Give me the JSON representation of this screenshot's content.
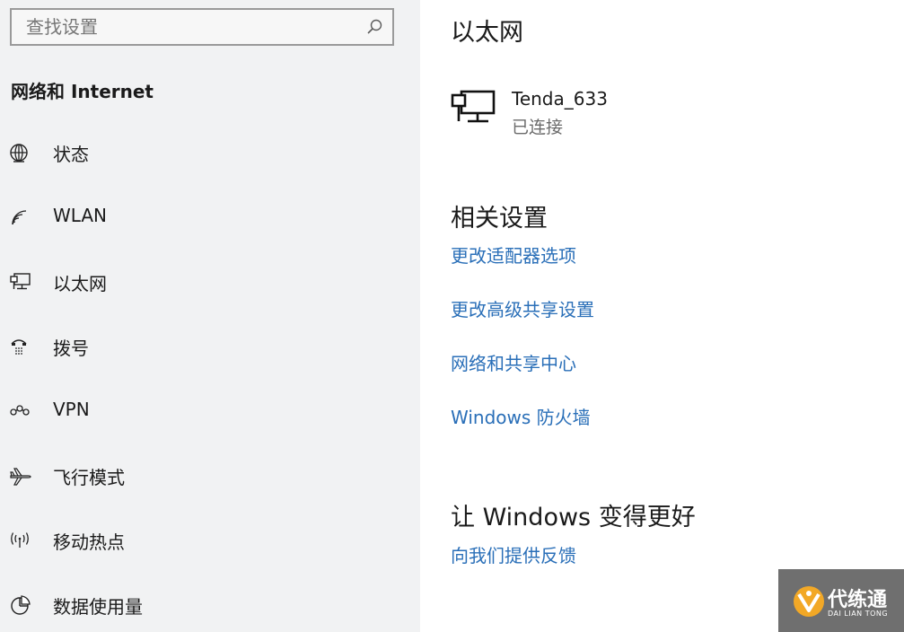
{
  "search": {
    "placeholder": "查找设置",
    "icon": "search-icon"
  },
  "sidebar": {
    "heading": "网络和 Internet",
    "items": [
      {
        "label": "状态",
        "icon": "globe-icon"
      },
      {
        "label": "WLAN",
        "icon": "wifi-icon"
      },
      {
        "label": "以太网",
        "icon": "ethernet-icon"
      },
      {
        "label": "拨号",
        "icon": "dialup-icon"
      },
      {
        "label": "VPN",
        "icon": "vpn-icon"
      },
      {
        "label": "飞行模式",
        "icon": "airplane-icon"
      },
      {
        "label": "移动热点",
        "icon": "hotspot-icon"
      },
      {
        "label": "数据使用量",
        "icon": "data-usage-icon"
      }
    ]
  },
  "main": {
    "title": "以太网",
    "network": {
      "name": "Tenda_633",
      "status": "已连接",
      "icon": "ethernet-icon"
    },
    "related": {
      "title": "相关设置",
      "links": [
        "更改适配器选项",
        "更改高级共享设置",
        "网络和共享中心",
        "Windows 防火墙"
      ]
    },
    "feedback": {
      "title": "让 Windows 变得更好",
      "link": "向我们提供反馈"
    }
  },
  "watermark": {
    "title": "代练通",
    "subtitle": "DAI LIAN TONG"
  },
  "colors": {
    "sidebar_bg": "#f1f2f3",
    "link": "#2a6fb8",
    "text": "#1a1a1a",
    "secondary_text": "#6b6b6b"
  }
}
